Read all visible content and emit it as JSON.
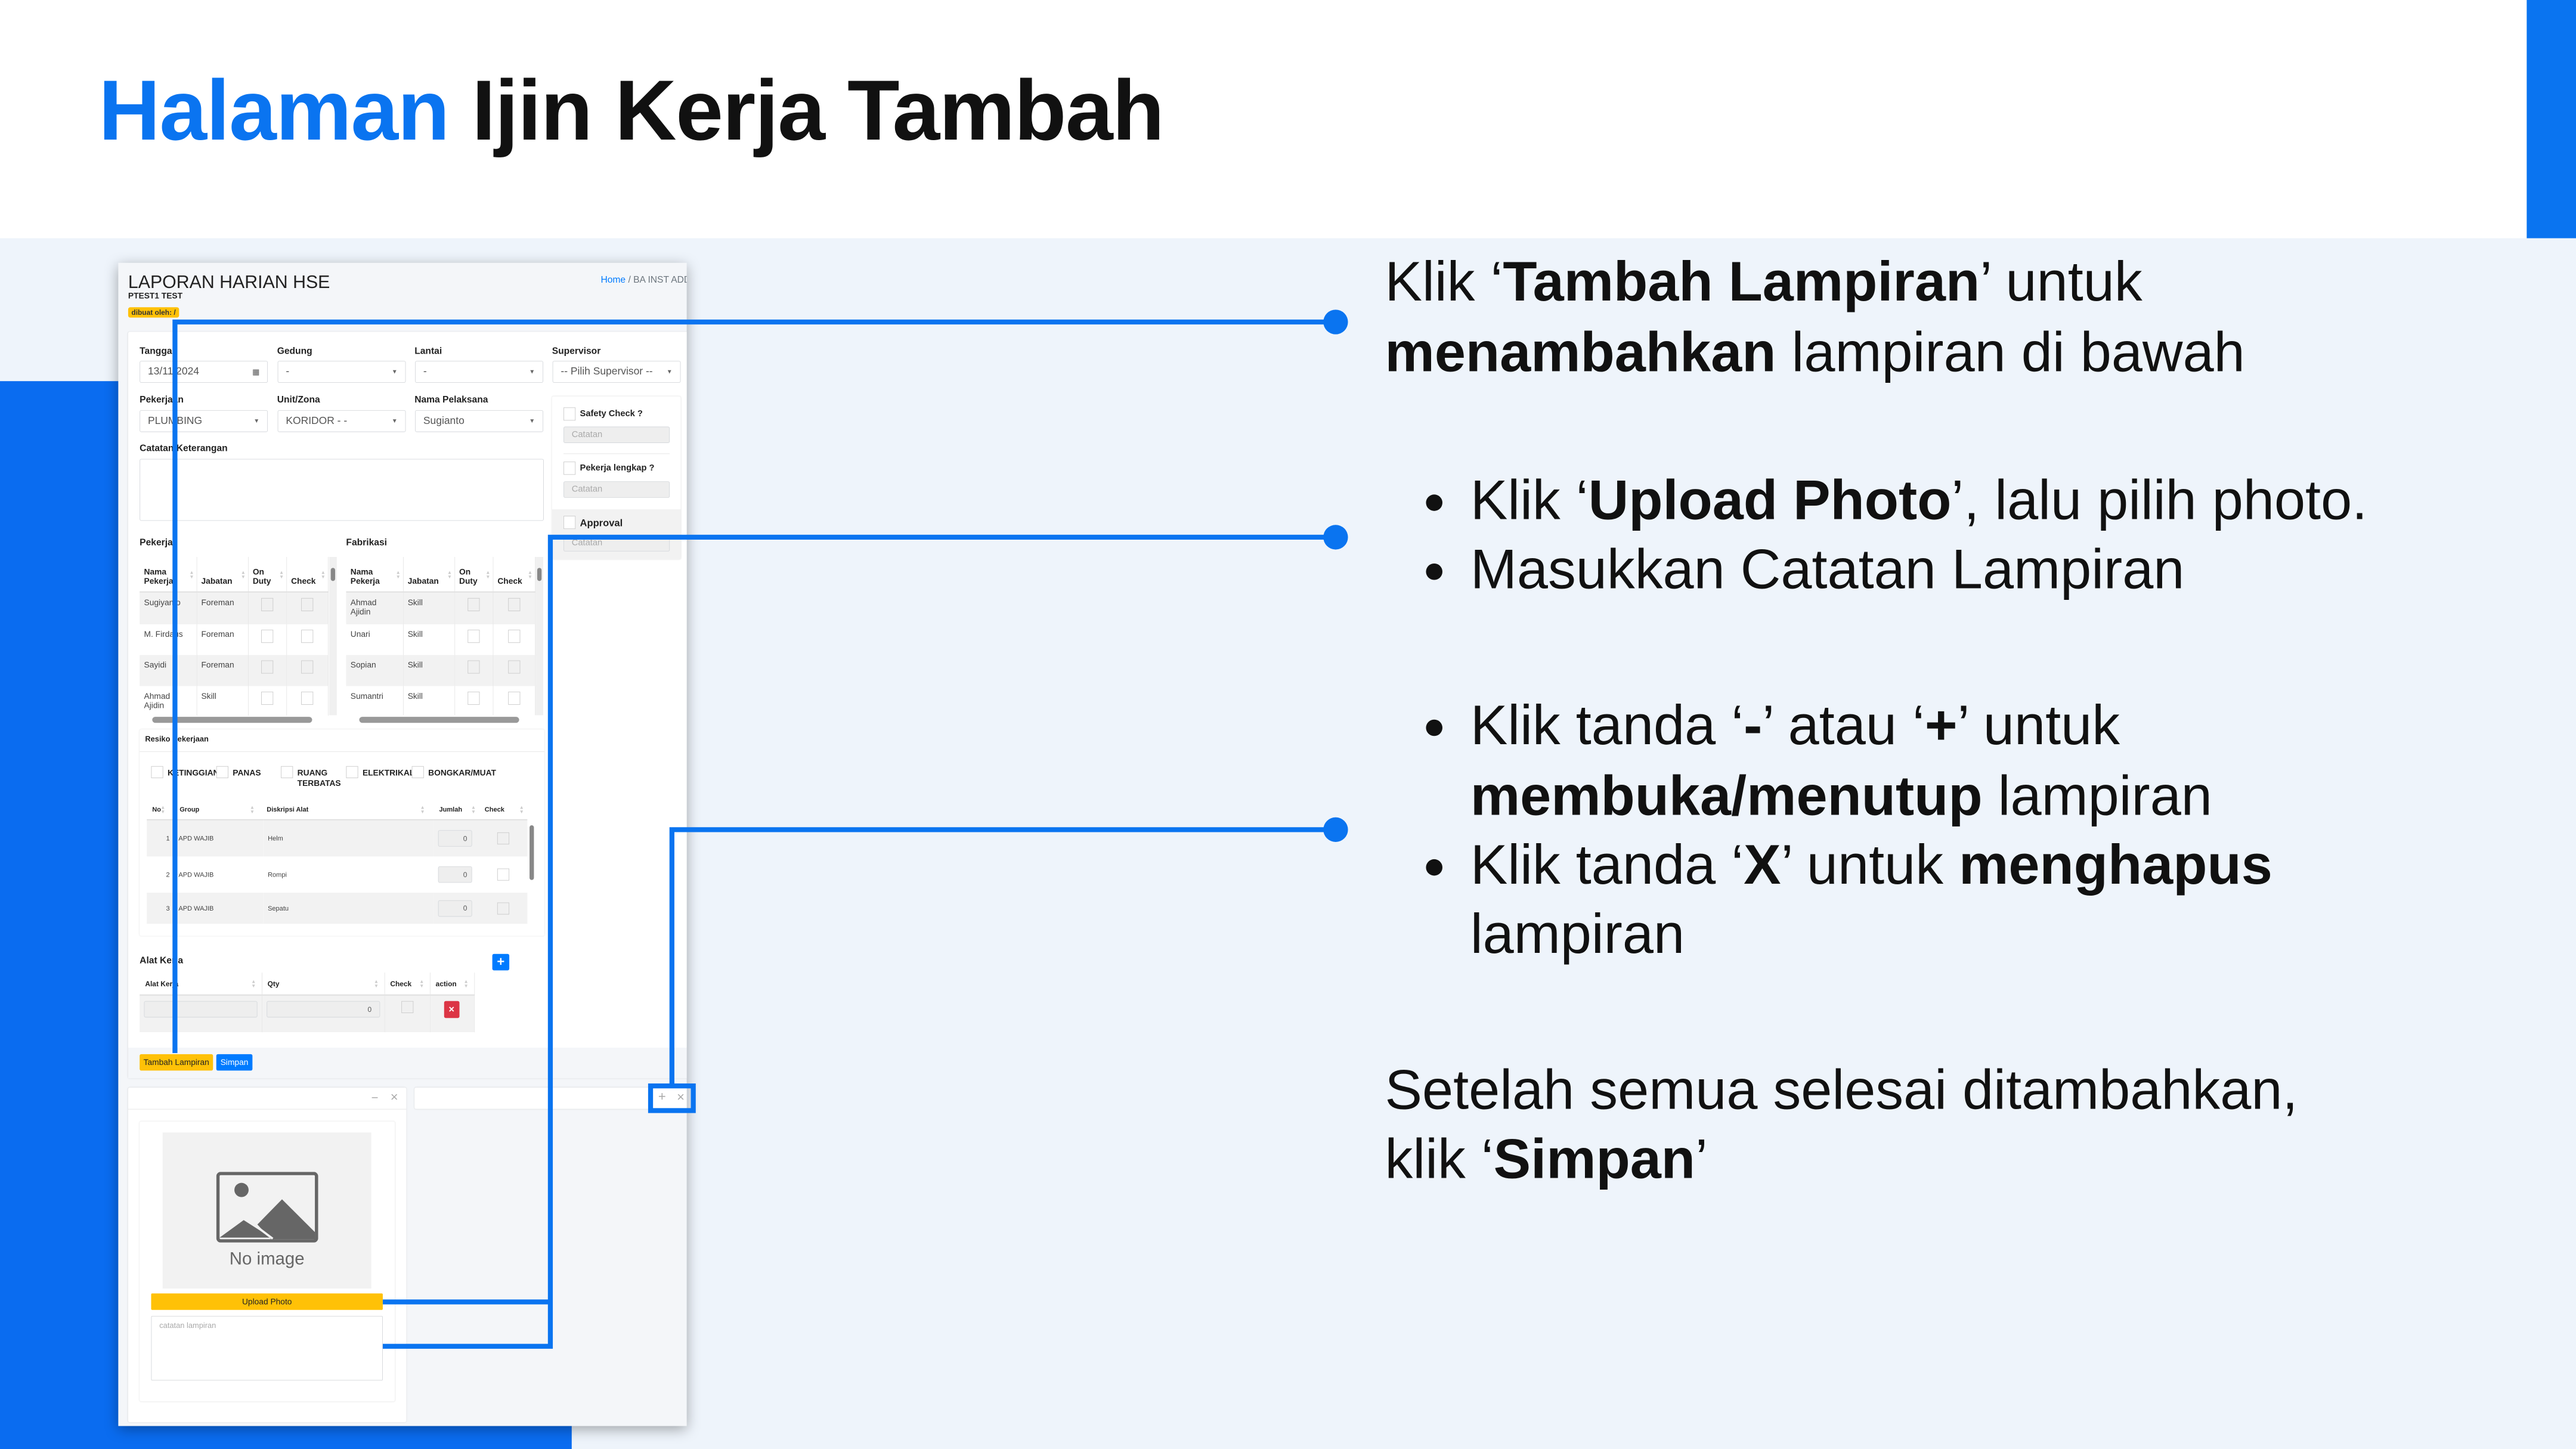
{
  "slide": {
    "title_highlight": "Halaman",
    "title_rest": " Ijin Kerja Tambah",
    "accent_color": "#0a74f0",
    "instructions": [
      [
        {
          "t": "Klik ‘"
        },
        {
          "t": "Tambah Lampiran",
          "b": true
        },
        {
          "t": "’ untuk"
        }
      ],
      [
        {
          "t": "menambahkan",
          "b": true
        },
        {
          "t": " lampiran di bawah"
        }
      ],
      [
        {
          "t": "Klik ‘"
        },
        {
          "t": "Upload Photo",
          "b": true
        },
        {
          "t": "’, lalu pilih photo."
        }
      ],
      [
        {
          "t": "Masukkan Catatan Lampiran"
        }
      ],
      [
        {
          "t": "Klik tanda ‘"
        },
        {
          "t": "-",
          "b": true
        },
        {
          "t": "’ atau ‘"
        },
        {
          "t": "+",
          "b": true
        },
        {
          "t": "’ untuk"
        }
      ],
      [
        {
          "t": "membuka/menutup",
          "b": true
        },
        {
          "t": " lampiran"
        }
      ],
      [
        {
          "t": "Klik tanda ‘"
        },
        {
          "t": "X",
          "b": true
        },
        {
          "t": "’ untuk "
        },
        {
          "t": "menghapus",
          "b": true
        }
      ],
      [
        {
          "t": "lampiran"
        }
      ],
      [
        {
          "t": "Setelah semua selesai ditambahkan,"
        }
      ],
      [
        {
          "t": "klik ‘"
        },
        {
          "t": "Simpan",
          "b": true
        },
        {
          "t": "’"
        }
      ]
    ]
  },
  "app": {
    "page_title": "LAPORAN HARIAN HSE",
    "company": "PTEST1 TEST",
    "created_by": "dibuat oleh: /",
    "breadcrumb": {
      "home": "Home",
      "sep": "/",
      "current": "BA INST ADD"
    },
    "form": {
      "tanggal": {
        "label": "Tanggal",
        "value": "13/11/2024"
      },
      "gedung": {
        "label": "Gedung",
        "value": "-"
      },
      "lantai": {
        "label": "Lantai",
        "value": "-"
      },
      "supervisor": {
        "label": "Supervisor",
        "value": "-- Pilih Supervisor --"
      },
      "pekerjaan": {
        "label": "Pekerjaan",
        "value": "PLUMBING"
      },
      "unit_zona": {
        "label": "Unit/Zona",
        "value": "KORIDOR - -"
      },
      "nama_pelaksana": {
        "label": "Nama Pelaksana",
        "value": "Sugianto"
      },
      "catatan_keterangan": {
        "label": "Catatan Keterangan",
        "value": ""
      }
    },
    "checks": {
      "safety": {
        "label": "Safety Check ?",
        "placeholder": "Catatan"
      },
      "pekerja_lengkap": {
        "label": "Pekerja lengkap ?",
        "placeholder": "Catatan"
      },
      "approval": {
        "label": "Approval",
        "placeholder": "Catatan"
      }
    },
    "pekerja": {
      "title": "Pekerja",
      "columns": [
        "Nama Pekerja",
        "Jabatan",
        "On Duty",
        "Check"
      ],
      "rows": [
        [
          "Sugiyanto",
          "Foreman"
        ],
        [
          "M. Firdaus",
          "Foreman"
        ],
        [
          "Sayidi",
          "Foreman"
        ],
        [
          "Ahmad Ajidin",
          "Skill"
        ]
      ]
    },
    "fabrikasi": {
      "title": "Fabrikasi",
      "columns": [
        "Nama Pekerja",
        "Jabatan",
        "On Duty",
        "Check"
      ],
      "rows": [
        [
          "Ahmad Ajidin",
          "Skill"
        ],
        [
          "Unari",
          "Skill"
        ],
        [
          "Sopian",
          "Skill"
        ],
        [
          "Sumantri",
          "Skill"
        ]
      ]
    },
    "resiko": {
      "title": "Resiko Pekerjaan",
      "options": [
        "KETINGGIAN",
        "PANAS",
        "RUANG TERBATAS",
        "ELEKTRIKAL",
        "BONGKAR/MUAT"
      ],
      "columns": [
        "No",
        "Group",
        "Diskripsi Alat",
        "Jumlah",
        "Check"
      ],
      "rows": [
        [
          "1",
          "APD WAJIB",
          "Helm",
          "0"
        ],
        [
          "2",
          "APD WAJIB",
          "Rompi",
          "0"
        ],
        [
          "3",
          "APD WAJIB",
          "Sepatu",
          "0"
        ]
      ]
    },
    "alat_kerja": {
      "title": "Alat Kerja",
      "add_label": "+",
      "columns": [
        "Alat Kerja",
        "Qty",
        "Check",
        "action"
      ],
      "row": {
        "alat": "",
        "qty": "0"
      }
    },
    "buttons": {
      "tambah_lampiran": "Tambah Lampiran",
      "simpan": "Simpan"
    },
    "lampiran": {
      "minimize": "−",
      "close": "×",
      "no_image": "No image",
      "upload": "Upload Photo",
      "note_placeholder": "catatan lampiran",
      "expand": "+"
    },
    "colors": {
      "primary": "#007bff",
      "warning": "#ffc107",
      "danger": "#dc3545"
    }
  }
}
